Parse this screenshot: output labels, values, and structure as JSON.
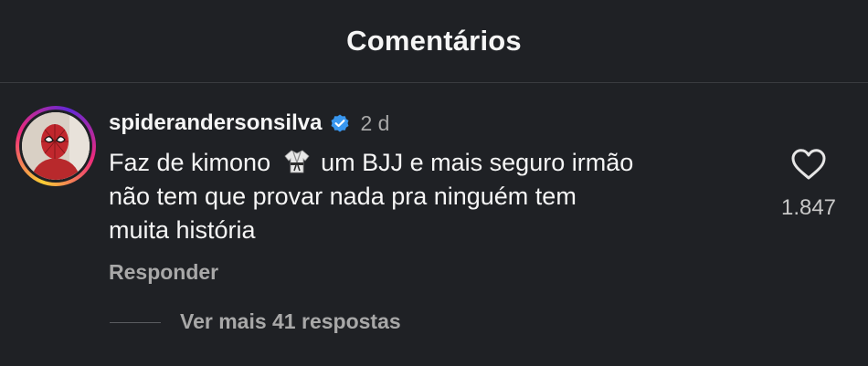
{
  "header": {
    "title": "Comentários"
  },
  "comment": {
    "username": "spiderandersonsilva",
    "verified": true,
    "time": "2 d",
    "text_line1_part1": "Faz de kimono",
    "text_line1_part2": "um BJJ e mais seguro irmão",
    "text_line2": "não tem que provar nada pra ninguém  tem",
    "text_line3": "muita história",
    "reply_label": "Responder",
    "view_replies_label": "Ver mais 41 respostas",
    "like_count": "1.847"
  },
  "icons": {
    "verified": "verified-badge-icon",
    "kimono": "martial-arts-uniform-icon",
    "like": "heart-outline-icon"
  },
  "colors": {
    "background": "#1f2125",
    "text": "#f5f5f5",
    "secondary_text": "#a8a8a8",
    "verified_blue": "#3897f0"
  }
}
